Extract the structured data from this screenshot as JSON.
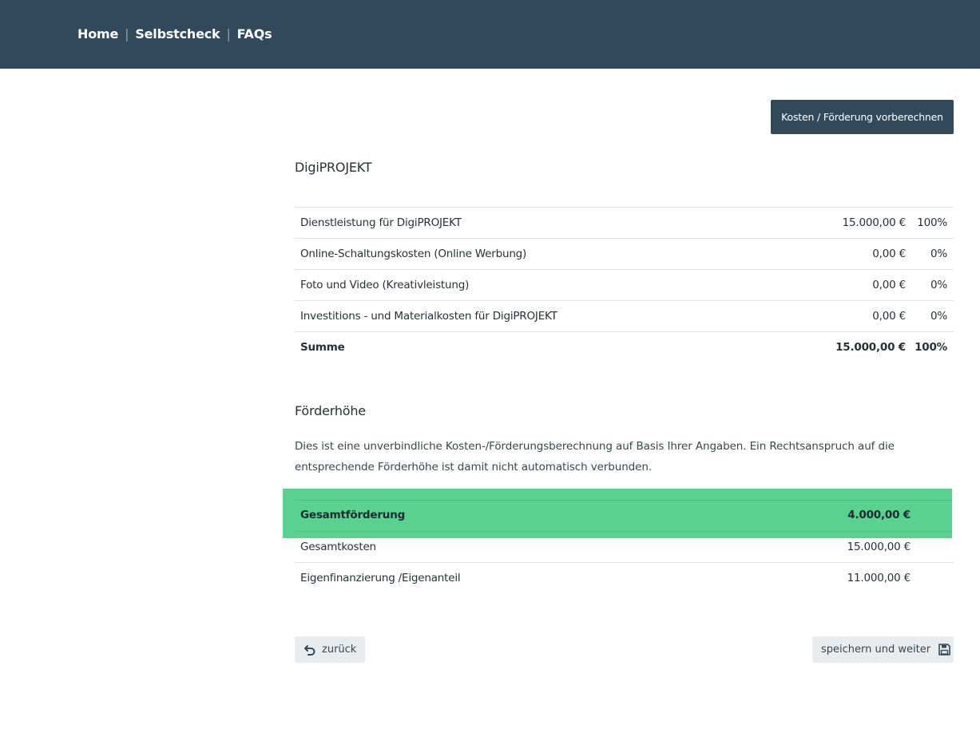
{
  "nav": {
    "items": [
      "Home",
      "Selbstcheck",
      "FAQs"
    ],
    "separator": "|"
  },
  "actions": {
    "calculate_label": "Kosten / Förderung vorberechnen",
    "back_label": "zurück",
    "save_label": "speichern und weiter"
  },
  "costs": {
    "title": "DigiPROJEKT",
    "rows": [
      {
        "label": "Dienstleistung für DigiPROJEKT",
        "amount": "15.000,00 €",
        "percent": "100%"
      },
      {
        "label": "Online-Schaltungskosten (Online Werbung)",
        "amount": "0,00 €",
        "percent": "0%"
      },
      {
        "label": "Foto und Video (Kreativleistung)",
        "amount": "0,00 €",
        "percent": "0%"
      },
      {
        "label": "Investitions - und Materialkosten für DigiPROJEKT",
        "amount": "0,00 €",
        "percent": "0%"
      }
    ],
    "sum": {
      "label": "Summe",
      "amount": "15.000,00 €",
      "percent": "100%"
    }
  },
  "funding": {
    "title": "Förderhöhe",
    "info": "Dies ist eine unverbindliche Kosten-/Förderungsberechnung auf Basis Ihrer Angaben. Ein Rechtsanspruch auf die entsprechende Förderhöhe ist damit nicht automatisch verbunden.",
    "total": {
      "label": "Gesamtförderung",
      "value": "4.000,00 €"
    },
    "rows": [
      {
        "label": "Gesamtkosten",
        "value": "15.000,00 €"
      },
      {
        "label": "Eigenfinanzierung /Eigenanteil",
        "value": "11.000,00 €"
      }
    ]
  },
  "icons": {
    "back": "undo-arrow-icon",
    "save": "floppy-disk-icon"
  },
  "colors": {
    "header": "#31495a",
    "highlight": "#59d18f",
    "button_bg": "#e9ecee"
  }
}
